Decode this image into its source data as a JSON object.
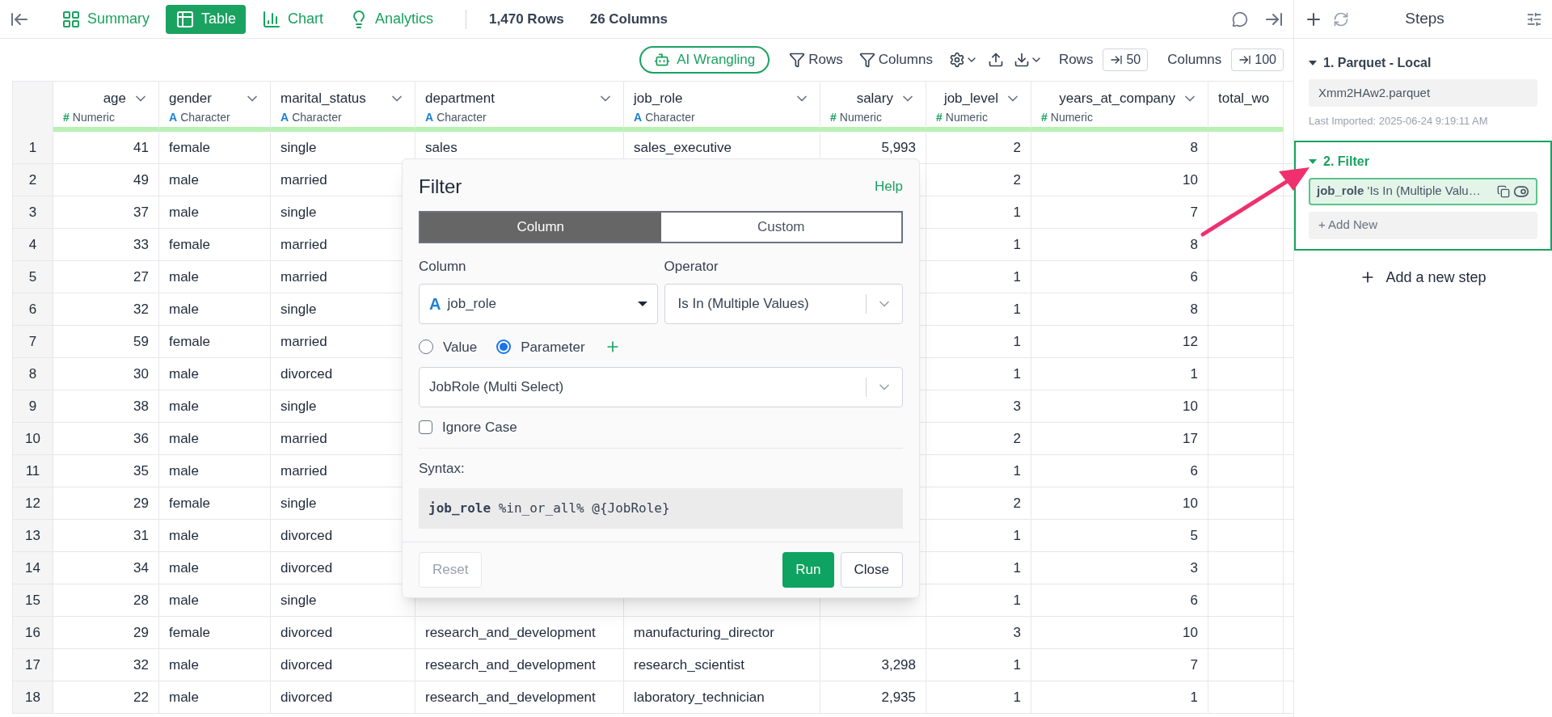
{
  "view_tabs": [
    {
      "label": "Summary",
      "kind": "summary",
      "selected": false
    },
    {
      "label": "Table",
      "kind": "table",
      "selected": true
    },
    {
      "label": "Chart",
      "kind": "chart",
      "selected": false
    },
    {
      "label": "Analytics",
      "kind": "analytics",
      "selected": false
    }
  ],
  "stats": [
    "1,470 Rows",
    "26 Columns"
  ],
  "toolbar": {
    "ai_button": "AI Wrangling",
    "rows_filter": "Rows",
    "columns_filter": "Columns",
    "rows_label": "Rows",
    "rows_value": "50",
    "columns_label": "Columns",
    "columns_value": "100"
  },
  "table": {
    "columns": [
      {
        "name": "age",
        "kind": "numeric",
        "mark": "#",
        "type": "Numeric"
      },
      {
        "name": "gender",
        "kind": "character",
        "mark": "A",
        "type": "Character"
      },
      {
        "name": "marital_status",
        "kind": "character",
        "mark": "A",
        "type": "Character"
      },
      {
        "name": "department",
        "kind": "character",
        "mark": "A",
        "type": "Character"
      },
      {
        "name": "job_role",
        "kind": "character",
        "mark": "A",
        "type": "Character"
      },
      {
        "name": "salary",
        "kind": "numeric",
        "mark": "#",
        "type": "Numeric"
      },
      {
        "name": "job_level",
        "kind": "numeric",
        "mark": "#",
        "type": "Numeric"
      },
      {
        "name": "years_at_company",
        "kind": "numeric",
        "mark": "#",
        "type": "Numeric"
      },
      {
        "name": "total_wo",
        "kind": "cut"
      }
    ],
    "rows": [
      {
        "index": "1",
        "cells": [
          "41",
          "female",
          "single",
          "sales",
          "sales_executive",
          "5,993",
          "2",
          "8"
        ]
      },
      {
        "index": "2",
        "cells": [
          "49",
          "male",
          "married",
          null,
          null,
          null,
          "2",
          "10"
        ]
      },
      {
        "index": "3",
        "cells": [
          "37",
          "male",
          "single",
          null,
          null,
          null,
          "1",
          "7"
        ]
      },
      {
        "index": "4",
        "cells": [
          "33",
          "female",
          "married",
          null,
          null,
          null,
          "1",
          "8"
        ]
      },
      {
        "index": "5",
        "cells": [
          "27",
          "male",
          "married",
          null,
          null,
          null,
          "1",
          "6"
        ]
      },
      {
        "index": "6",
        "cells": [
          "32",
          "male",
          "single",
          null,
          null,
          null,
          "1",
          "8"
        ]
      },
      {
        "index": "7",
        "cells": [
          "59",
          "female",
          "married",
          null,
          null,
          null,
          "1",
          "12"
        ]
      },
      {
        "index": "8",
        "cells": [
          "30",
          "male",
          "divorced",
          null,
          null,
          null,
          "1",
          "1"
        ]
      },
      {
        "index": "9",
        "cells": [
          "38",
          "male",
          "single",
          null,
          null,
          null,
          "3",
          "10"
        ]
      },
      {
        "index": "10",
        "cells": [
          "36",
          "male",
          "married",
          null,
          null,
          null,
          "2",
          "17"
        ]
      },
      {
        "index": "11",
        "cells": [
          "35",
          "male",
          "married",
          null,
          null,
          null,
          "1",
          "6"
        ]
      },
      {
        "index": "12",
        "cells": [
          "29",
          "female",
          "single",
          null,
          null,
          null,
          "2",
          "10"
        ]
      },
      {
        "index": "13",
        "cells": [
          "31",
          "male",
          "divorced",
          null,
          null,
          null,
          "1",
          "5"
        ]
      },
      {
        "index": "14",
        "cells": [
          "34",
          "male",
          "divorced",
          null,
          null,
          null,
          "1",
          "3"
        ]
      },
      {
        "index": "15",
        "cells": [
          "28",
          "male",
          "single",
          null,
          null,
          null,
          "1",
          "6"
        ]
      },
      {
        "index": "16",
        "cells": [
          "29",
          "female",
          "divorced",
          "research_and_development",
          "manufacturing_director",
          null,
          "3",
          "10"
        ]
      },
      {
        "index": "17",
        "cells": [
          "32",
          "male",
          "divorced",
          "research_and_development",
          "research_scientist",
          "3,298",
          "1",
          "7"
        ]
      },
      {
        "index": "18",
        "cells": [
          "22",
          "male",
          "divorced",
          "research_and_development",
          "laboratory_technician",
          "2,935",
          "1",
          "1"
        ]
      }
    ]
  },
  "filter_dialog": {
    "title": "Filter",
    "help": "Help",
    "modes": [
      {
        "label": "Column",
        "selected": true
      },
      {
        "label": "Custom",
        "selected": false
      }
    ],
    "column_label": "Column",
    "column_mark": "A",
    "column_value": "job_role",
    "operator_label": "Operator",
    "operator_value": "Is In (Multiple Values)",
    "sources": [
      {
        "label": "Value",
        "selected": false
      },
      {
        "label": "Parameter",
        "selected": true
      }
    ],
    "parameter_value": "JobRole (Multi Select)",
    "ignore_case": {
      "label": "Ignore Case",
      "checked": false
    },
    "syntax_label": "Syntax:",
    "syntax": "**job_role** %in_or_all% @{JobRole}",
    "buttons": {
      "reset": "Reset",
      "run": "Run",
      "close": "Close"
    }
  },
  "steps_panel": {
    "title": "Steps",
    "steps": [
      {
        "title": "1. Parquet - Local",
        "expanded": true,
        "selected": false,
        "file": "Xmm2HAw2.parquet",
        "note": "Last Imported: 2025-06-24 9:19:11 AM"
      },
      {
        "title": "2. Filter",
        "expanded": true,
        "selected": true,
        "condition": "**job_role** 'Is In (Multiple Valu…",
        "add": "+ Add New"
      }
    ],
    "add_step": "Add a new step"
  }
}
